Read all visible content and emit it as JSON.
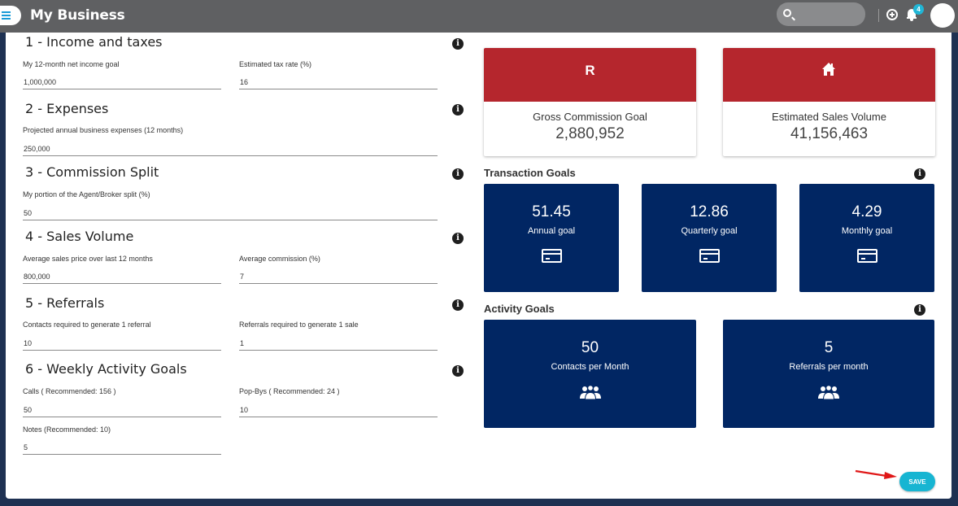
{
  "app": {
    "title": "My Business",
    "notifications_count": "4"
  },
  "form": {
    "sections": [
      {
        "title": "1 - Income and taxes",
        "fields": [
          {
            "label": "My 12-month net income goal",
            "value": "1,000,000"
          },
          {
            "label": "Estimated tax rate (%)",
            "value": "16"
          }
        ]
      },
      {
        "title": "2 - Expenses",
        "fields": [
          {
            "label": "Projected annual business expenses (12 months)",
            "value": "250,000"
          }
        ]
      },
      {
        "title": "3 - Commission Split",
        "fields": [
          {
            "label": "My portion of the Agent/Broker split (%)",
            "value": "50"
          }
        ]
      },
      {
        "title": "4 - Sales Volume",
        "fields": [
          {
            "label": "Average sales price over last 12 months",
            "value": "800,000"
          },
          {
            "label": "Average commission (%)",
            "value": "7"
          }
        ]
      },
      {
        "title": "5 - Referrals",
        "fields": [
          {
            "label": "Contacts required to generate 1 referral",
            "value": "10"
          },
          {
            "label": "Referrals required to generate 1 sale",
            "value": "1"
          }
        ]
      },
      {
        "title": "6 - Weekly Activity Goals",
        "fields": [
          {
            "label": "Calls ( Recommended: 156 )",
            "value": "50"
          },
          {
            "label": "Pop-Bys ( Recommended: 24 )",
            "value": "10"
          },
          {
            "label": "Notes (Recommended: 10)",
            "value": "5"
          }
        ]
      }
    ]
  },
  "summary": {
    "gross_commission": {
      "symbol": "R",
      "label": "Gross Commission Goal",
      "value": "2,880,952"
    },
    "sales_volume": {
      "icon": "house-icon",
      "label": "Estimated Sales Volume",
      "value": "41,156,463"
    }
  },
  "transaction_goals": {
    "title": "Transaction Goals",
    "items": [
      {
        "value": "51.45",
        "label": "Annual goal",
        "icon": "credit-card-icon"
      },
      {
        "value": "12.86",
        "label": "Quarterly goal",
        "icon": "credit-card-icon"
      },
      {
        "value": "4.29",
        "label": "Monthly goal",
        "icon": "credit-card-icon"
      }
    ]
  },
  "activity_goals": {
    "title": "Activity Goals",
    "items": [
      {
        "value": "50",
        "label": "Contacts per Month",
        "icon": "people-icon"
      },
      {
        "value": "5",
        "label": "Referrals per month",
        "icon": "people-icon"
      }
    ]
  },
  "actions": {
    "save_label": "SAVE"
  },
  "colors": {
    "accent_red": "#b5262d",
    "navy": "#012663",
    "save": "#17b5d2",
    "topbar": "#5f6062"
  }
}
